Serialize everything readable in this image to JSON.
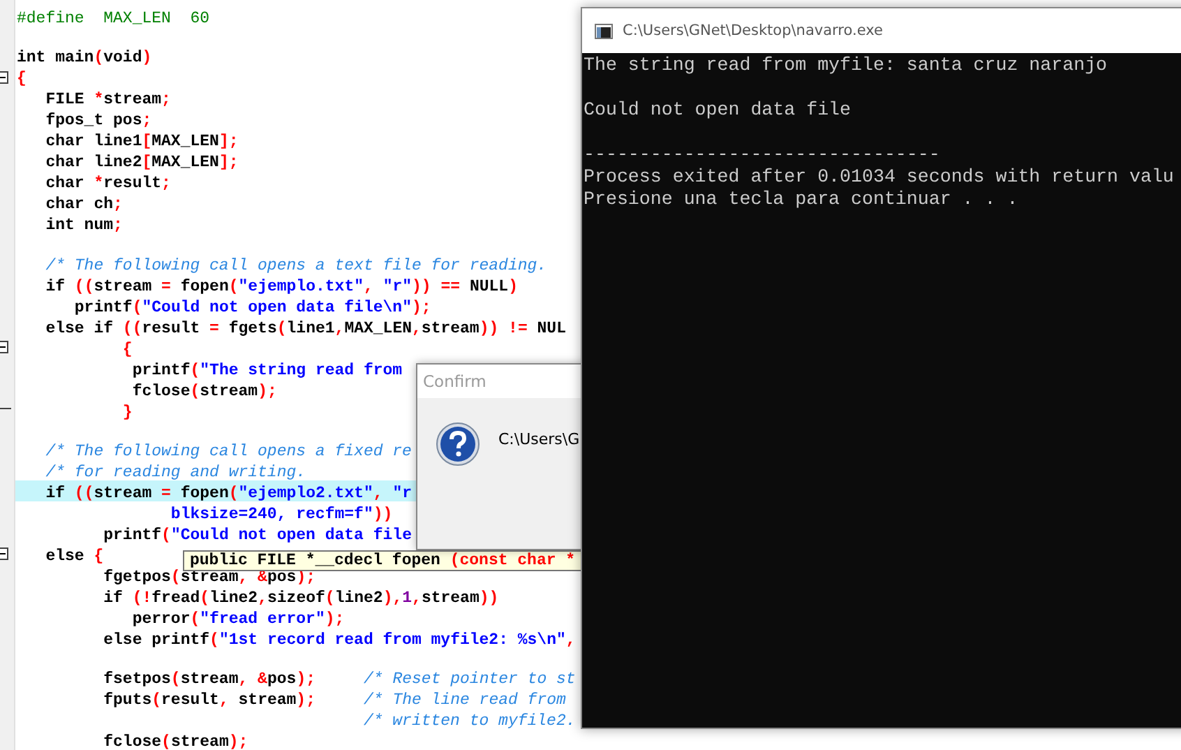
{
  "editor": {
    "lines": [
      {
        "kind": "code",
        "highlighted": false,
        "segments": [
          {
            "kind": "define",
            "text": "#define  MAX_LEN  60"
          }
        ]
      },
      {
        "kind": "code",
        "highlighted": false
      },
      {
        "kind": "code",
        "highlighted": false,
        "segments": [
          {
            "kind": "plain",
            "text": "int main"
          },
          {
            "kind": "punct",
            "text": "("
          },
          {
            "kind": "plain",
            "text": "void"
          },
          {
            "kind": "punct",
            "text": ")"
          }
        ]
      },
      {
        "kind": "fold",
        "highlighted": false,
        "segments": [
          {
            "kind": "punct",
            "text": "{"
          }
        ]
      },
      {
        "kind": "code",
        "highlighted": false,
        "segments": [
          {
            "kind": "plain",
            "text": "   FILE "
          },
          {
            "kind": "punct",
            "text": "*"
          },
          {
            "kind": "plain",
            "text": "stream"
          },
          {
            "kind": "punct",
            "text": ";"
          }
        ]
      },
      {
        "kind": "code",
        "highlighted": false,
        "segments": [
          {
            "kind": "plain",
            "text": "   fpos_t pos"
          },
          {
            "kind": "punct",
            "text": ";"
          }
        ]
      },
      {
        "kind": "code",
        "highlighted": false,
        "segments": [
          {
            "kind": "plain",
            "text": "   char line1"
          },
          {
            "kind": "punct",
            "text": "["
          },
          {
            "kind": "plain",
            "text": "MAX_LEN"
          },
          {
            "kind": "punct",
            "text": "];"
          }
        ]
      },
      {
        "kind": "code",
        "highlighted": false,
        "segments": [
          {
            "kind": "plain",
            "text": "   char line2"
          },
          {
            "kind": "punct",
            "text": "["
          },
          {
            "kind": "plain",
            "text": "MAX_LEN"
          },
          {
            "kind": "punct",
            "text": "];"
          }
        ]
      },
      {
        "kind": "code",
        "highlighted": false,
        "segments": [
          {
            "kind": "plain",
            "text": "   char "
          },
          {
            "kind": "punct",
            "text": "*"
          },
          {
            "kind": "plain",
            "text": "result"
          },
          {
            "kind": "punct",
            "text": ";"
          }
        ]
      },
      {
        "kind": "code",
        "highlighted": false,
        "segments": [
          {
            "kind": "plain",
            "text": "   char ch"
          },
          {
            "kind": "punct",
            "text": ";"
          }
        ]
      },
      {
        "kind": "code",
        "highlighted": false,
        "segments": [
          {
            "kind": "plain",
            "text": "   int num"
          },
          {
            "kind": "punct",
            "text": ";"
          }
        ]
      },
      {
        "kind": "code",
        "highlighted": false
      },
      {
        "kind": "code",
        "highlighted": false,
        "segments": [
          {
            "kind": "comment",
            "text": "   /* The following call opens a text file for reading."
          }
        ]
      },
      {
        "kind": "code",
        "highlighted": false,
        "segments": [
          {
            "kind": "plain",
            "text": "   if "
          },
          {
            "kind": "punct",
            "text": "(("
          },
          {
            "kind": "plain",
            "text": "stream "
          },
          {
            "kind": "punct",
            "text": "="
          },
          {
            "kind": "plain",
            "text": " fopen"
          },
          {
            "kind": "punct",
            "text": "("
          },
          {
            "kind": "string",
            "text": "\"ejemplo.txt\""
          },
          {
            "kind": "punct",
            "text": ", "
          },
          {
            "kind": "string",
            "text": "\"r\""
          },
          {
            "kind": "punct",
            "text": ")) =="
          },
          {
            "kind": "plain",
            "text": " NULL"
          },
          {
            "kind": "punct",
            "text": ")"
          }
        ]
      },
      {
        "kind": "code",
        "highlighted": false,
        "segments": [
          {
            "kind": "plain",
            "text": "      printf"
          },
          {
            "kind": "punct",
            "text": "("
          },
          {
            "kind": "string",
            "text": "\"Could not open data file\\n\""
          },
          {
            "kind": "punct",
            "text": ");"
          }
        ]
      },
      {
        "kind": "code",
        "highlighted": false,
        "segments": [
          {
            "kind": "plain",
            "text": "   else if "
          },
          {
            "kind": "punct",
            "text": "(("
          },
          {
            "kind": "plain",
            "text": "result "
          },
          {
            "kind": "punct",
            "text": "="
          },
          {
            "kind": "plain",
            "text": " fgets"
          },
          {
            "kind": "punct",
            "text": "("
          },
          {
            "kind": "plain",
            "text": "line1"
          },
          {
            "kind": "punct",
            "text": ","
          },
          {
            "kind": "plain",
            "text": "MAX_LEN"
          },
          {
            "kind": "punct",
            "text": ","
          },
          {
            "kind": "plain",
            "text": "stream"
          },
          {
            "kind": "punct",
            "text": ")) !="
          },
          {
            "kind": "plain",
            "text": " NUL"
          }
        ]
      },
      {
        "kind": "fold",
        "highlighted": false,
        "segments": [
          {
            "kind": "punct",
            "text": "           {"
          }
        ]
      },
      {
        "kind": "code",
        "highlighted": false,
        "segments": [
          {
            "kind": "plain",
            "text": "            printf"
          },
          {
            "kind": "punct",
            "text": "("
          },
          {
            "kind": "string",
            "text": "\"The string read from"
          }
        ]
      },
      {
        "kind": "code",
        "highlighted": false,
        "segments": [
          {
            "kind": "plain",
            "text": "            fclose"
          },
          {
            "kind": "punct",
            "text": "("
          },
          {
            "kind": "plain",
            "text": "stream"
          },
          {
            "kind": "punct",
            "text": ");"
          }
        ]
      },
      {
        "kind": "foldend",
        "highlighted": false,
        "segments": [
          {
            "kind": "punct",
            "text": "           }"
          }
        ]
      },
      {
        "kind": "code",
        "highlighted": false
      },
      {
        "kind": "code",
        "highlighted": false,
        "segments": [
          {
            "kind": "comment",
            "text": "   /* The following call opens a fixed re"
          }
        ]
      },
      {
        "kind": "code",
        "highlighted": false,
        "segments": [
          {
            "kind": "comment",
            "text": "   /* for reading and writing."
          }
        ]
      },
      {
        "kind": "code",
        "highlighted": true,
        "segments": [
          {
            "kind": "plain",
            "text": "   if "
          },
          {
            "kind": "punct",
            "text": "(("
          },
          {
            "kind": "plain",
            "text": "stream "
          },
          {
            "kind": "punct",
            "text": "="
          },
          {
            "kind": "plain",
            "text": " fopen"
          },
          {
            "kind": "punct",
            "text": "("
          },
          {
            "kind": "string",
            "text": "\"ejemplo2.txt\""
          },
          {
            "kind": "punct",
            "text": ", "
          },
          {
            "kind": "string",
            "text": "\"r"
          }
        ]
      },
      {
        "kind": "code",
        "highlighted": false,
        "segments": [
          {
            "kind": "string",
            "text": "                blksize=240, recfm=f\""
          },
          {
            "kind": "punct",
            "text": "))"
          }
        ]
      },
      {
        "kind": "code",
        "highlighted": false,
        "segments": [
          {
            "kind": "plain",
            "text": "         printf"
          },
          {
            "kind": "punct",
            "text": "("
          },
          {
            "kind": "string",
            "text": "\"Could not open data file"
          }
        ]
      },
      {
        "kind": "fold",
        "highlighted": false,
        "segments": [
          {
            "kind": "plain",
            "text": "   else "
          },
          {
            "kind": "punct",
            "text": "{"
          }
        ]
      },
      {
        "kind": "code",
        "highlighted": false,
        "segments": [
          {
            "kind": "plain",
            "text": "         fgetpos"
          },
          {
            "kind": "punct",
            "text": "("
          },
          {
            "kind": "plain",
            "text": "stream"
          },
          {
            "kind": "punct",
            "text": ", &"
          },
          {
            "kind": "plain",
            "text": "pos"
          },
          {
            "kind": "punct",
            "text": ");"
          }
        ]
      },
      {
        "kind": "code",
        "highlighted": false,
        "segments": [
          {
            "kind": "plain",
            "text": "         if "
          },
          {
            "kind": "punct",
            "text": "(!"
          },
          {
            "kind": "plain",
            "text": "fread"
          },
          {
            "kind": "punct",
            "text": "("
          },
          {
            "kind": "plain",
            "text": "line2"
          },
          {
            "kind": "punct",
            "text": ","
          },
          {
            "kind": "plain",
            "text": "sizeof"
          },
          {
            "kind": "punct",
            "text": "("
          },
          {
            "kind": "plain",
            "text": "line2"
          },
          {
            "kind": "punct",
            "text": "),"
          },
          {
            "kind": "number",
            "text": "1"
          },
          {
            "kind": "punct",
            "text": ","
          },
          {
            "kind": "plain",
            "text": "stream"
          },
          {
            "kind": "punct",
            "text": "))"
          }
        ]
      },
      {
        "kind": "code",
        "highlighted": false,
        "segments": [
          {
            "kind": "plain",
            "text": "            perror"
          },
          {
            "kind": "punct",
            "text": "("
          },
          {
            "kind": "string",
            "text": "\"fread error\""
          },
          {
            "kind": "punct",
            "text": ");"
          }
        ]
      },
      {
        "kind": "code",
        "highlighted": false,
        "segments": [
          {
            "kind": "plain",
            "text": "         else printf"
          },
          {
            "kind": "punct",
            "text": "("
          },
          {
            "kind": "string",
            "text": "\"1st record read from myfile2: %s\\n\""
          },
          {
            "kind": "punct",
            "text": ","
          }
        ]
      },
      {
        "kind": "code",
        "highlighted": false
      },
      {
        "kind": "code",
        "highlighted": false,
        "segments": [
          {
            "kind": "plain",
            "text": "         fsetpos"
          },
          {
            "kind": "punct",
            "text": "("
          },
          {
            "kind": "plain",
            "text": "stream"
          },
          {
            "kind": "punct",
            "text": ", &"
          },
          {
            "kind": "plain",
            "text": "pos"
          },
          {
            "kind": "punct",
            "text": ");"
          },
          {
            "kind": "comment",
            "text": "     /* Reset pointer to st"
          }
        ]
      },
      {
        "kind": "code",
        "highlighted": false,
        "segments": [
          {
            "kind": "plain",
            "text": "         fputs"
          },
          {
            "kind": "punct",
            "text": "("
          },
          {
            "kind": "plain",
            "text": "result"
          },
          {
            "kind": "punct",
            "text": ","
          },
          {
            "kind": "plain",
            "text": " stream"
          },
          {
            "kind": "punct",
            "text": ");"
          },
          {
            "kind": "comment",
            "text": "     /* The line read from"
          }
        ]
      },
      {
        "kind": "code",
        "highlighted": false,
        "segments": [
          {
            "kind": "comment",
            "text": "                                    /* written to myfile2."
          }
        ]
      },
      {
        "kind": "code",
        "highlighted": false,
        "segments": [
          {
            "kind": "plain",
            "text": "         fclose"
          },
          {
            "kind": "punct",
            "text": "("
          },
          {
            "kind": "plain",
            "text": "stream"
          },
          {
            "kind": "punct",
            "text": ");"
          }
        ]
      }
    ]
  },
  "tooltip": {
    "segments": [
      {
        "kind": "plain",
        "text": "public FILE *__cdecl fopen "
      },
      {
        "kind": "punct",
        "text": "(const char *"
      }
    ]
  },
  "confirm_dialog": {
    "title": "Confirm",
    "message": "C:\\Users\\G"
  },
  "console_window": {
    "title": "C:\\Users\\GNet\\Desktop\\navarro.exe",
    "blocks": [
      [
        "The string read from myfile: santa cruz naranjo"
      ],
      [
        "Could not open data file"
      ],
      [
        "--------------------------------",
        "Process exited after 0.01034 seconds with return valu",
        "Presione una tecla para continuar . . ."
      ]
    ]
  }
}
